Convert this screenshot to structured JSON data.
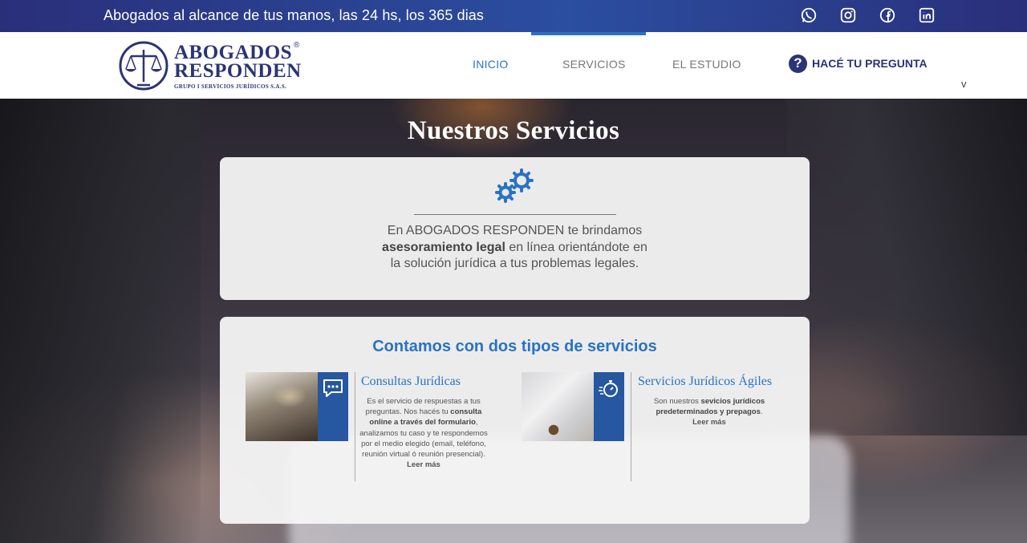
{
  "topbar": {
    "tagline": "Abogados al alcance de tus manos, las 24 hs, los 365 dias",
    "social": [
      "whatsapp-icon",
      "instagram-icon",
      "facebook-icon",
      "linkedin-icon"
    ]
  },
  "header": {
    "logo": {
      "line1": "ABOGADOS",
      "registered": "®",
      "line2": "RESPONDEN",
      "subline": "GRUPO I SERVICIOS JURÍDICOS S.A.S."
    },
    "nav": {
      "inicio": "INICIO",
      "servicios": "SERVICIOS",
      "estudio": "EL ESTUDIO",
      "ask": "HACÉ TU PREGUNTA",
      "ask_icon_glyph": "?",
      "chevron": "v"
    }
  },
  "hero": {
    "title": "Nuestros Servicios",
    "intro": {
      "part1": "En ABOGADOS RESPONDEN te brindamos",
      "bold": "asesoramiento legal",
      "part2": "en línea orientándote en la solución jurídica a tus problemas legales."
    }
  },
  "services": {
    "heading": "Contamos con dos tipos de servicios",
    "consultas": {
      "title": "Consultas Jurídicas",
      "desc1": "Es el servicio de respuestas a tus preguntas. Nos hacés tu",
      "bold1": "consulta online a través del formulario",
      "desc2": ", analizamos tu caso y te respondemos por el medio elegido (email, teléfono, reunión virtual ó reunión presencial).",
      "more": "Leer más"
    },
    "agiles": {
      "title": "Servicios Jurídicos Ágiles",
      "desc1": "Son nuestros",
      "bold1": "sevicios jurídicos predeterminados y prepagos",
      "desc2": ".",
      "more": "Leer más"
    }
  },
  "colors": {
    "brand_navy": "#2b3474",
    "accent_blue": "#2a73c2",
    "topbar_blue": "#2b4ea0"
  }
}
